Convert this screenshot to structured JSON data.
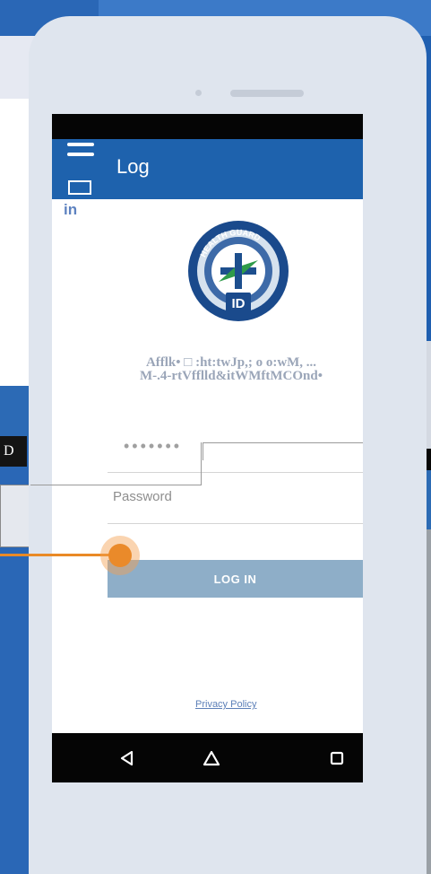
{
  "app_bar": {
    "title": "Log",
    "subtitle_fragment": "in"
  },
  "logo": {
    "ring_text": "HEALTH GUARD",
    "center_text": "ID"
  },
  "tagline": {
    "line1": "Afflk• □ :ht:twJp,; o o:wM, ...",
    "line2": "M-.4-rtVfflld&itWMftMCOnd•"
  },
  "form": {
    "password_value": "•••••••",
    "password_placeholder": "Password",
    "login_label": "LOG IN"
  },
  "privacy_link": "Privacy Policy",
  "left_label": "D",
  "colors": {
    "app_bar": "#1e62ad",
    "login_button": "#8eaec8",
    "accent": "#ea8a2a",
    "background": "#1f5fb0"
  },
  "icons": {
    "menu": "hamburger-menu-icon",
    "back": "triangle-back-icon",
    "home": "home-icon",
    "recents": "square-recents-icon",
    "phone2_back": "arrow-left-icon"
  },
  "phone2": {
    "back_glyph": "←"
  }
}
